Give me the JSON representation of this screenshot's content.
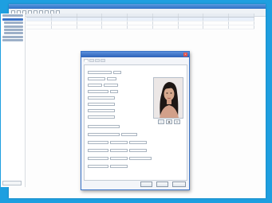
{
  "app": {
    "title": ""
  },
  "grid": {
    "columns": [
      "",
      "",
      "",
      "",
      "",
      "",
      "",
      "",
      ""
    ],
    "rows": [
      [
        "",
        "",
        "",
        "",
        "",
        "",
        "",
        "",
        ""
      ],
      [
        "",
        "",
        "",
        "",
        "",
        "",
        "",
        "",
        ""
      ],
      [
        "",
        "",
        "",
        "",
        "",
        "",
        "",
        "",
        ""
      ]
    ]
  },
  "dialog": {
    "title": "",
    "tabs": [
      "",
      "",
      "",
      ""
    ],
    "fields": [
      "",
      "",
      "",
      "",
      "",
      "",
      "",
      "",
      "",
      "",
      "",
      "",
      "",
      "",
      "",
      ""
    ],
    "buttons": {
      "ok": "",
      "cancel": ""
    }
  },
  "colors": {
    "background": "#1e9fe0",
    "accent": "#3a73c8"
  }
}
